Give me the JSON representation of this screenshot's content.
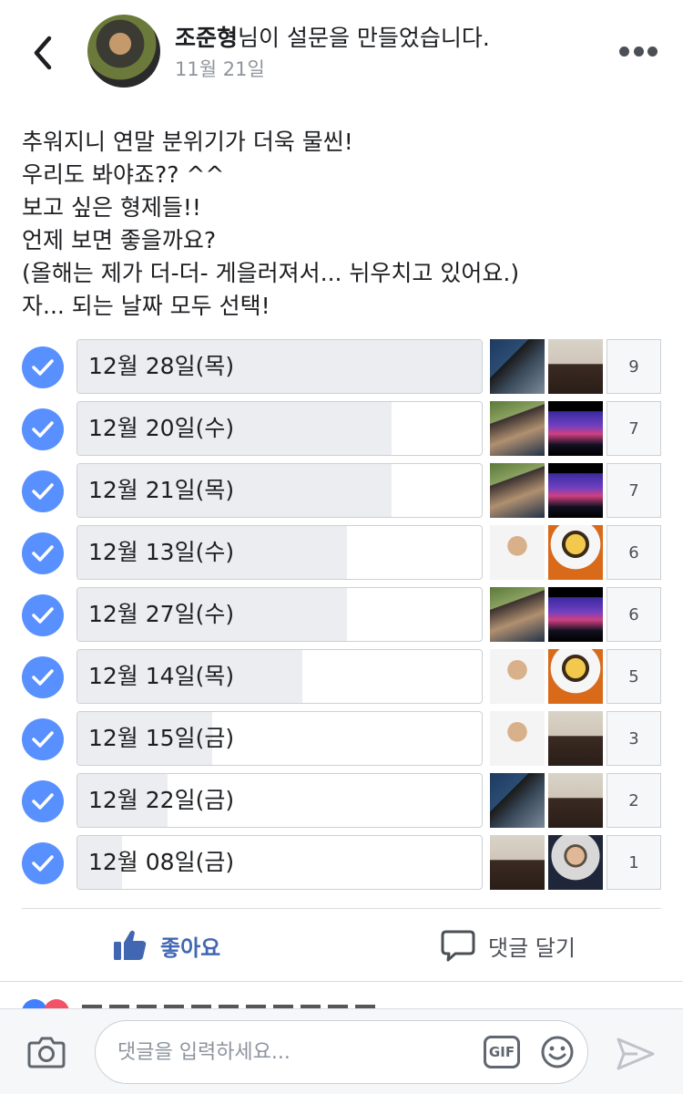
{
  "post": {
    "author": "조준형",
    "title_suffix": "님이 설문을 만들었습니다.",
    "date": "11월 21일",
    "text_lines": [
      "추워지니 연말 분위기가 더욱 물씬!",
      "우리도 봐야죠?? ^^",
      "보고 싶은 형제들!!",
      "언제 보면 좋을까요?",
      "(올해는 제가 더-더- 게을러져서... 뉘우치고 있어요.)",
      "자... 되는 날짜 모두 선택!"
    ]
  },
  "poll": {
    "options": [
      {
        "label": "12월 28일(목)",
        "votes": "9",
        "voters": [
          "photo-office",
          "photo-suit"
        ]
      },
      {
        "label": "12월 20일(수)",
        "votes": "7",
        "voters": [
          "photo-cafe",
          "photo-concert"
        ]
      },
      {
        "label": "12월 21일(목)",
        "votes": "7",
        "voters": [
          "photo-cafe",
          "photo-concert"
        ]
      },
      {
        "label": "12월 13일(수)",
        "votes": "6",
        "voters": [
          "photo-smile",
          "photo-cartoon"
        ]
      },
      {
        "label": "12월 27일(수)",
        "votes": "6",
        "voters": [
          "photo-cafe",
          "photo-concert"
        ]
      },
      {
        "label": "12월 14일(목)",
        "votes": "5",
        "voters": [
          "photo-smile",
          "photo-cartoon"
        ]
      },
      {
        "label": "12월 15일(금)",
        "votes": "3",
        "voters": [
          "photo-smile",
          "photo-suit"
        ]
      },
      {
        "label": "12월 22일(금)",
        "votes": "2",
        "voters": [
          "photo-office",
          "photo-suit"
        ]
      },
      {
        "label": "12월 08일(금)",
        "votes": "1",
        "voters": [
          "photo-suit",
          "photo-formal"
        ]
      }
    ]
  },
  "actions": {
    "like_label": "좋아요",
    "comment_label": "댓글 달기"
  },
  "composer": {
    "placeholder": "댓글을 입력하세요...",
    "gif_label": "GIF"
  },
  "colors": {
    "accent": "#5890ff",
    "like_blue": "#4267b2",
    "bar_fill": "#ebedf0",
    "border": "#ccd0d5"
  }
}
